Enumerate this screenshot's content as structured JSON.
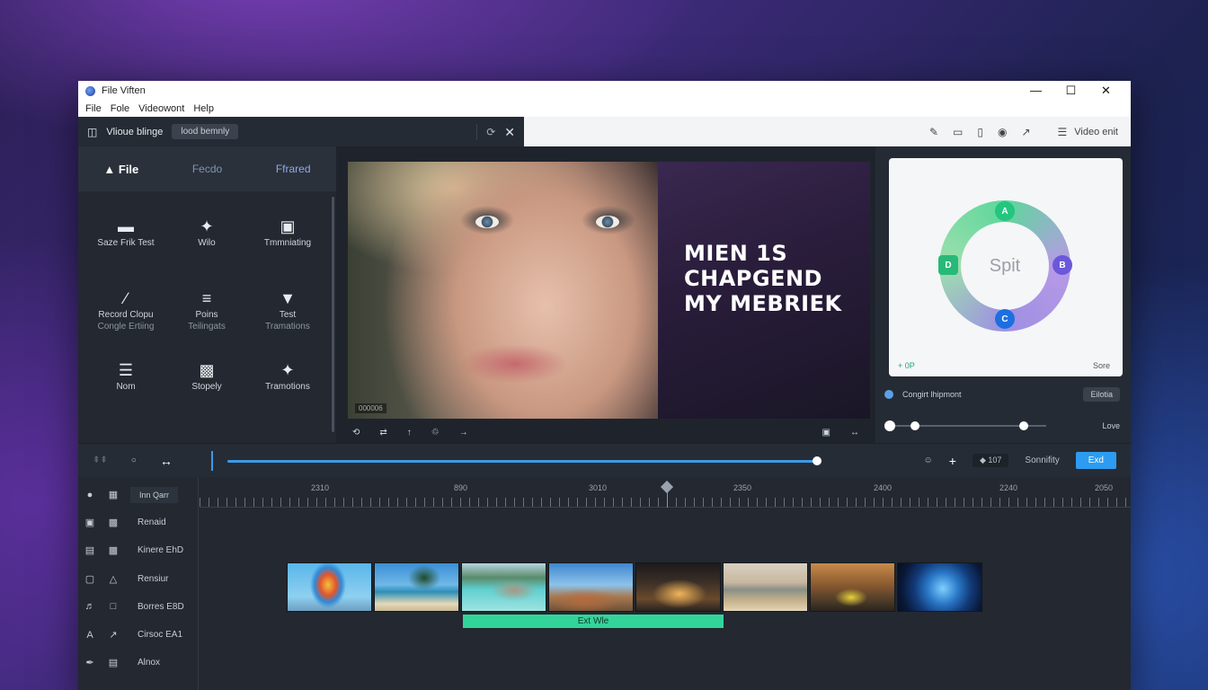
{
  "window": {
    "title": "File Viften",
    "controls": [
      "—",
      "☐",
      "✕"
    ]
  },
  "menu": [
    "File",
    "Fole",
    "Videowont",
    "Help"
  ],
  "toolbar": {
    "project_name": "Vlioue blinge",
    "search_pill": "lood bemnly",
    "right_label": "Video enit"
  },
  "left_panel": {
    "tabs": [
      "File",
      "Fecdo",
      "Ffrared"
    ],
    "tools": [
      {
        "label": "Saze Frik Test",
        "sub": "",
        "icon": "▬"
      },
      {
        "label": "Wilo",
        "sub": "",
        "icon": "✦"
      },
      {
        "label": "Tmmniating",
        "sub": "",
        "icon": "▣"
      },
      {
        "label": "Record Clopu",
        "sub": "Congle Ertiing",
        "icon": "∕"
      },
      {
        "label": "Poins",
        "sub": "Teilingats",
        "icon": "≡"
      },
      {
        "label": "Test",
        "sub": "Tramations",
        "icon": "▼"
      },
      {
        "label": "Nom",
        "sub": "",
        "icon": "☰"
      },
      {
        "label": "Stopely",
        "sub": "",
        "icon": "▩"
      },
      {
        "label": "Tramotions",
        "sub": "",
        "icon": "✦"
      }
    ]
  },
  "preview": {
    "headline": [
      "MIEN 1S",
      "CHAPGEND",
      "MY MEBRIEK"
    ],
    "watermark": "000006",
    "controls_left": [
      "⟲",
      "⇄",
      "↑",
      "♲",
      "→"
    ],
    "controls_right": [
      "▣",
      "↔"
    ]
  },
  "right_panel": {
    "ring_label": "Spit",
    "nodes": [
      "A",
      "B",
      "C",
      "D"
    ],
    "card_left": "+ 0P",
    "card_right": "Sore",
    "row1_label": "Congirt lhipmont",
    "row1_chip": "Eilotia",
    "slider_label": "Love",
    "slider_values": [
      0.0,
      0.17,
      0.88
    ]
  },
  "scrub": {
    "left_icons": [
      "⇞⇞",
      "○",
      "↔"
    ],
    "progress": 1.0,
    "right_icons": [
      "☺",
      "+"
    ],
    "zoom_chip": "◆ 107",
    "label": "Sonnifity",
    "exit_button": "Exd"
  },
  "timeline": {
    "tracks": [
      {
        "label": "Inn Qarr"
      },
      {
        "label": "Renaid"
      },
      {
        "label": "Kinere EhD"
      },
      {
        "label": "Rensiur"
      },
      {
        "label": "Borres E8D"
      },
      {
        "label": "Cirsoc EA1"
      },
      {
        "label": "Alnox"
      }
    ],
    "ruler": [
      "2310",
      "890",
      "3010",
      "2350",
      "2400",
      "2240",
      "2050"
    ],
    "clip_label": "Ext Wle"
  }
}
